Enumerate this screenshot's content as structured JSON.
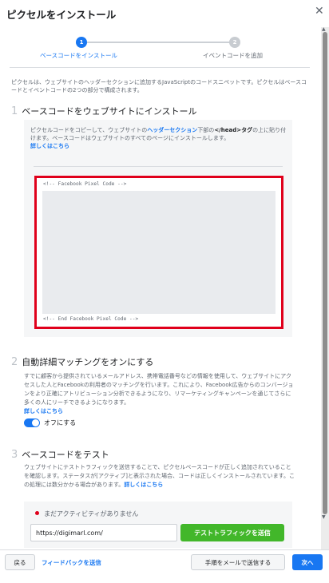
{
  "dialog": {
    "title": "ピクセルをインストール",
    "close_glyph": "✕"
  },
  "stepper": {
    "step1": {
      "number": "1",
      "label": "ベースコードをインストール"
    },
    "step2": {
      "number": "2",
      "label": "イベントコードを追加"
    }
  },
  "intro": "ピクセルは、ウェブサイトのヘッダーセクションに追加するJavaScriptのコードスニペットです。ピクセルはベースコードとイベントコードの2つの部分で構成されます。",
  "section1": {
    "number": "1",
    "title": "ベースコードをウェブサイトにインストール",
    "text_before": "ピクセルコードをコピーして、ウェブサイトの",
    "text_header": "ヘッダーセクション",
    "text_middle": "下部の",
    "text_tag": "</head>タグ",
    "text_after": "の上に貼り付けます。ベースコードはウェブサイトのすべてのページにインストールします。",
    "learn_more": "詳しくはこちら",
    "code_start": "<!-- Facebook Pixel Code -->",
    "code_end": "<!-- End Facebook Pixel Code -->"
  },
  "section2": {
    "number": "2",
    "title": "自動詳細マッチングをオンにする",
    "description": "すでに顧客から提供されているメールアドレス、携帯電話番号などの情報を使用して、ウェブサイトにアクセスした人とFacebookの利用者のマッチングを行います。これにより、Facebook広告からのコンバージョンをより正確にアトリビューション分析できるようになり、リマーケティングキャンペーンを通じてさらに多くの人にリーチできるようになります。",
    "learn_more": "詳しくはこちら",
    "toggle_label": "オフにする",
    "toggle_on": true
  },
  "section3": {
    "number": "3",
    "title": "ベースコードをテスト",
    "description": "ウェブサイトにテストトラフィックを送信することで、ピクセルベースコードが正しく追加されていることを確認します。ステータスが[アクティブ]と表示された場合、コードは正しくインストールされています。この処理には数分かかる場合があります。",
    "learn_more": "詳しくはこちら",
    "status": "まだアクティビティがありません",
    "status_color": "#e0001b",
    "url_value": "https://digimarl.com/",
    "send_button": "テストトラフィックを送信"
  },
  "footer": {
    "back": "戻る",
    "feedback": "フィードバックを送信",
    "email": "手順をメールで送信する",
    "next": "次へ"
  },
  "colors": {
    "accent": "#1877f2",
    "success": "#42b72a",
    "highlight_border": "#e0001b"
  }
}
